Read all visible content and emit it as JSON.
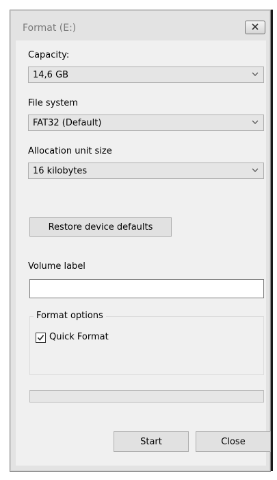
{
  "window": {
    "title": "Format  (E:)"
  },
  "capacity": {
    "label": "Capacity:",
    "value": "14,6 GB"
  },
  "file_system": {
    "label": "File system",
    "value": "FAT32 (Default)"
  },
  "allocation": {
    "label": "Allocation unit size",
    "value": "16 kilobytes"
  },
  "restore_button": "Restore device defaults",
  "volume": {
    "label": "Volume label",
    "value": ""
  },
  "format_options": {
    "title": "Format options",
    "quick_format": {
      "label": "Quick Format",
      "checked": true
    }
  },
  "progress": {
    "fraction": 0
  },
  "buttons": {
    "start": "Start",
    "close": "Close"
  },
  "icons": {
    "close": "close-icon",
    "dropdown": "chevron-down-icon",
    "check": "checkmark-icon"
  }
}
